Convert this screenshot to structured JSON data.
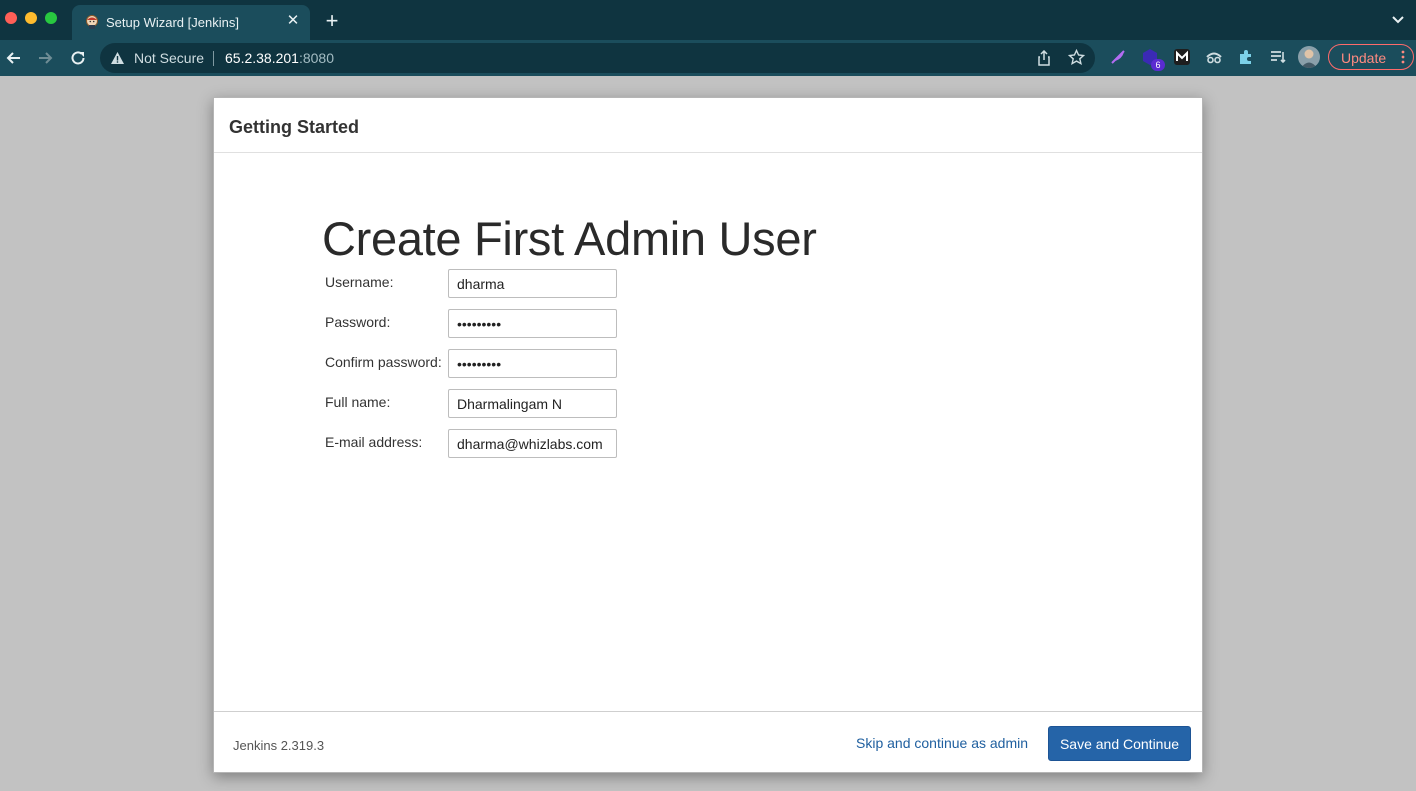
{
  "browser": {
    "tab_title": "Setup Wizard [Jenkins]",
    "security_label": "Not Secure",
    "url_host": "65.2.38.201",
    "url_port": ":8080",
    "extension_badge": "6",
    "update_label": "Update",
    "accent_color": "#1b4d5c"
  },
  "dialog": {
    "header_title": "Getting Started",
    "heading": "Create First Admin User",
    "fields": [
      {
        "label": "Username:",
        "value": "dharma"
      },
      {
        "label": "Password:",
        "value": "•••••••••"
      },
      {
        "label": "Confirm password:",
        "value": "•••••••••"
      },
      {
        "label": "Full name:",
        "value": "Dharmalingam N"
      },
      {
        "label": "E-mail address:",
        "value": "dharma@whizlabs.com"
      }
    ],
    "version": "Jenkins 2.319.3",
    "skip_label": "Skip and continue as admin",
    "save_label": "Save and Continue",
    "primary_color": "#2564a8"
  }
}
